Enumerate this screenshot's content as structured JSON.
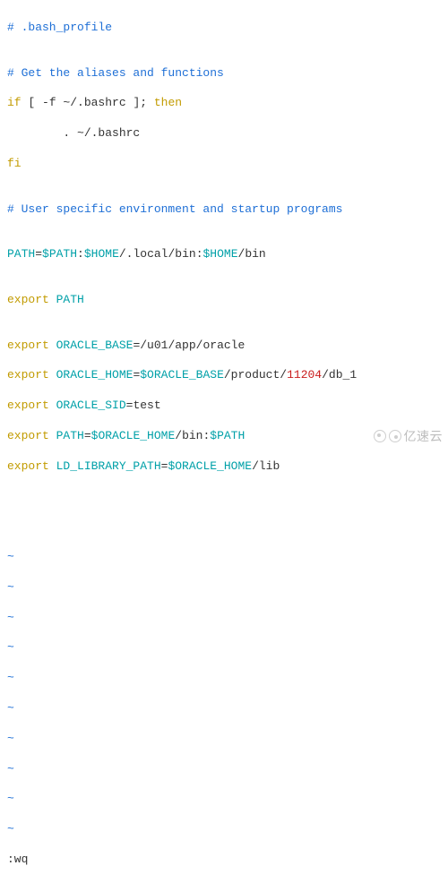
{
  "lines": {
    "l1_comment": "# .bash_profile",
    "l2_blank": "",
    "l3_comment": "# Get the aliases and functions",
    "l4_if": "if",
    "l4_cond_open": " [ -f ",
    "l4_path": "~/.bashrc",
    "l4_cond_close": " ]; ",
    "l4_then": "then",
    "l5_indent": "        . ",
    "l5_path": "~/.bashrc",
    "l6_fi": "fi",
    "l7_blank": "",
    "l8_comment": "# User specific environment and startup programs",
    "l9_blank": "",
    "l10_var": "PATH",
    "l10_eq": "=",
    "l10_v1": "$PATH",
    "l10_c1": ":",
    "l10_v2": "$HOME",
    "l10_p1": "/.local/bin:",
    "l10_v3": "$HOME",
    "l10_p2": "/bin",
    "l11_blank": "",
    "l12_export": "export",
    "l12_var": " PATH",
    "l13_blank": "",
    "l14_export": "export",
    "l14_var": " ORACLE_BASE",
    "l14_eq": "=",
    "l14_val": "/u01/app/oracle",
    "l15_export": "export",
    "l15_var": " ORACLE_HOME",
    "l15_eq": "=",
    "l15_v1": "$ORACLE_BASE",
    "l15_p1": "/product/",
    "l15_red": "11204",
    "l15_p2": "/db_1",
    "l16_export": "export",
    "l16_var": " ORACLE_SID",
    "l16_eq": "=",
    "l16_val": "test",
    "l17_export": "export",
    "l17_var": " PATH",
    "l17_eq": "=",
    "l17_v1": "$ORACLE_HOME",
    "l17_p1": "/bin:",
    "l17_v2": "$PATH",
    "l18_export": "export",
    "l18_var": " LD_LIBRARY_PATH",
    "l18_eq": "=",
    "l18_v1": "$ORACLE_HOME",
    "l18_p1": "/lib"
  },
  "tilde": "~",
  "command": ":wq",
  "watermark": "亿速云"
}
